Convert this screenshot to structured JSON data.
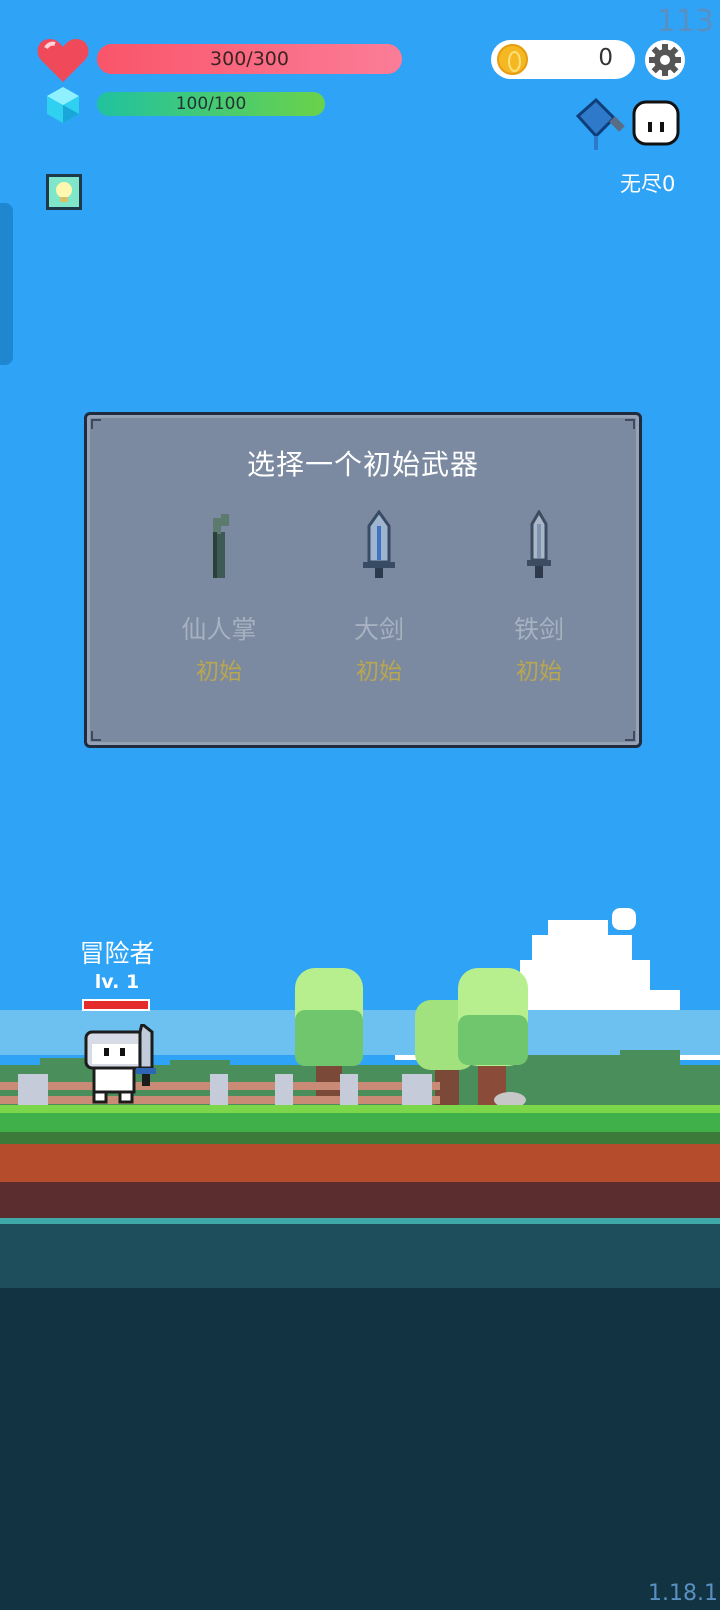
{
  "hud": {
    "fps": "113",
    "hp": {
      "text": "300/300",
      "ratio": 1.0
    },
    "mp": {
      "text": "100/100",
      "ratio": 1.0
    },
    "coins": "0",
    "mode_label": "无尽0"
  },
  "weapon_dialog": {
    "title": "选择一个初始武器",
    "options": [
      {
        "name": "仙人掌",
        "tag": "初始",
        "icon": "cactus-weapon-icon"
      },
      {
        "name": "大剑",
        "tag": "初始",
        "icon": "greatsword-icon"
      },
      {
        "name": "铁剑",
        "tag": "初始",
        "icon": "iron-sword-icon"
      }
    ]
  },
  "player": {
    "name": "冒险者",
    "level": "lv. 1"
  },
  "version": "1.18.1",
  "colors": {
    "sky": "#2fa3f5",
    "hp": "#f9556a",
    "mp": "#20c29f",
    "panel": "#7b8aa1",
    "tag": "#b9a650"
  }
}
